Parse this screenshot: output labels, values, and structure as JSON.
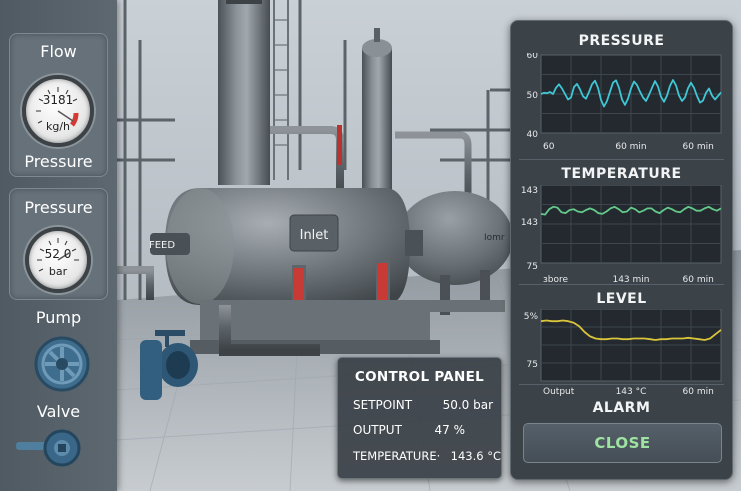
{
  "left_panel": {
    "flow_gauge": {
      "title": "Flow",
      "value": "3181",
      "unit": "kg/h",
      "caption": "Pressure"
    },
    "pressure_gauge": {
      "title": "Pressure",
      "value": "52 0",
      "unit": "bar"
    },
    "pump_label": "Pump",
    "valve_label": "Valve"
  },
  "scene": {
    "feed_label": "FEED",
    "vessel_label": "Inlet",
    "vessel2_label": "Iomr"
  },
  "control_panel": {
    "title": "CONTROL PANEL",
    "rows": [
      {
        "label": "SETPOINT",
        "value": "50.0 bar"
      },
      {
        "label": "OUTPUT",
        "value": "47 %"
      },
      {
        "label": "TEMPERATURE·",
        "value": "143.6 °C"
      }
    ]
  },
  "right_panel": {
    "alarm_title": "ALARM",
    "close_label": "CLOSE"
  },
  "colors": {
    "pressure_line": "#3fc7d6",
    "temperature_line": "#63c98a",
    "level_line": "#d9c43a",
    "plot_bg": "#23292e",
    "grid": "#3d464d",
    "close_text": "#9fe3a2"
  },
  "chart_data": [
    {
      "type": "line",
      "title": "PRESSURE",
      "yticks": [
        "60",
        "50",
        "40"
      ],
      "xticks": [
        "60",
        "60 min",
        "60 min"
      ],
      "ylim": [
        40,
        60
      ],
      "grid": true,
      "series": [
        {
          "values": [
            50,
            50.3,
            50.2,
            50.5,
            50,
            51.6,
            52.5,
            51.4,
            50,
            48.6,
            49.1,
            51.8,
            52.6,
            51.2,
            49.4,
            48.8,
            50.5,
            52.5,
            53.4,
            51.6,
            48.5,
            46.8,
            48.2,
            50.6,
            52.9,
            53.5,
            51.6,
            48.6,
            47.2,
            48.8,
            51.4,
            53.2,
            52.3,
            50.6,
            49.1,
            48.2,
            49.8,
            51.6,
            53.3,
            51.9,
            49.3,
            48,
            49.6,
            52.1,
            53.6,
            52.2,
            49.6,
            48.2,
            49.1,
            51.5,
            52.9,
            51.6,
            49.5,
            47.8,
            48.3,
            50.3,
            51.4,
            49.6,
            48.6,
            49.5,
            50.4
          ]
        }
      ]
    },
    {
      "type": "line",
      "title": "TEMPERATURE",
      "yticks": [
        "143",
        "143",
        "75"
      ],
      "xticks": [
        "ɜbore",
        "143 min",
        "60 min"
      ],
      "ylim": [
        0,
        10
      ],
      "grid": true,
      "series": [
        {
          "values": [
            6.3,
            6.2,
            6.9,
            7.2,
            7.1,
            6.5,
            6.4,
            6.8,
            6.9,
            6.6,
            6.5,
            6.8,
            7,
            6.8,
            6.4,
            6.3,
            6.6,
            7,
            7.2,
            6.9,
            6.5,
            6.6,
            7.1,
            6.9,
            6.5,
            6.7,
            7,
            7,
            6.6,
            6.4,
            6.8,
            7.1,
            6.9,
            6.6,
            6.5,
            6.9,
            7.2,
            7,
            6.7,
            6.7,
            7,
            7.2,
            6.9,
            6.7,
            7
          ]
        }
      ]
    },
    {
      "type": "line",
      "title": "LEVEL",
      "yticks": [
        "5%",
        "75"
      ],
      "xticks": [
        "Output",
        "143 °C",
        "60 min"
      ],
      "ylim": [
        0,
        10
      ],
      "grid": true,
      "series": [
        {
          "values": [
            8.3,
            8.4,
            8.3,
            8.3,
            8.4,
            8.3,
            8.1,
            7.6,
            6.8,
            6.2,
            5.9,
            5.8,
            5.8,
            5.9,
            5.9,
            5.8,
            5.8,
            5.9,
            5.9,
            5.9,
            5.8,
            5.7,
            5.8,
            5.8,
            5.9,
            5.9,
            5.9,
            6,
            5.9,
            5.8,
            5.7,
            5.9,
            6.5,
            7.1
          ]
        }
      ]
    }
  ]
}
